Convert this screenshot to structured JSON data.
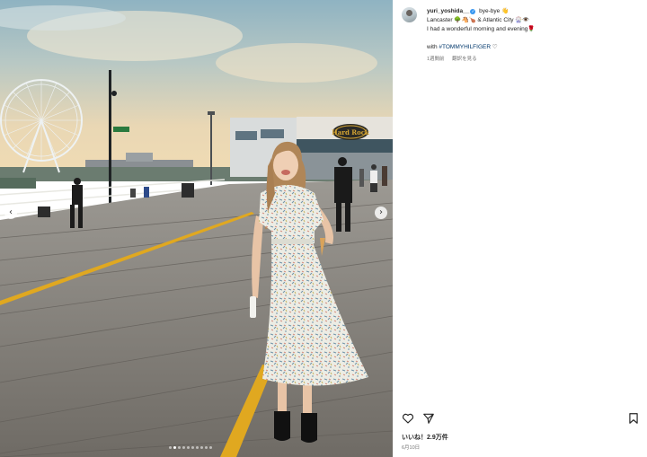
{
  "post": {
    "username": "yuri_yoshida__",
    "verified": true,
    "caption_line1": "bye-bye 👋",
    "caption_line2": "Lancaster 🌳🐴🍗 & Atlantic City 🎡👁️",
    "caption_line3": "I had a wonderful morning and evening🌹",
    "caption_with": "with",
    "caption_hashtag": "#TOMMYHILFIGER",
    "caption_heart": "♡",
    "time_ago": "1週間前",
    "translate_label": "翻訳を見る",
    "likes": "いいね！2.9万件",
    "date": "6月10日"
  },
  "carousel": {
    "prev_label": "‹",
    "next_label": "›",
    "slide_count": 10,
    "active_index": 1
  },
  "photo": {
    "sign_text": "Hard Rock"
  },
  "icons": {
    "verified": "verified-badge-icon",
    "heart": "heart-icon",
    "share": "share-icon",
    "save": "bookmark-icon"
  },
  "colors": {
    "verified_blue": "#3897f0",
    "hashtag": "#00376b",
    "meta_gray": "#737373",
    "boardwalk_yellow": "#e0a820"
  }
}
